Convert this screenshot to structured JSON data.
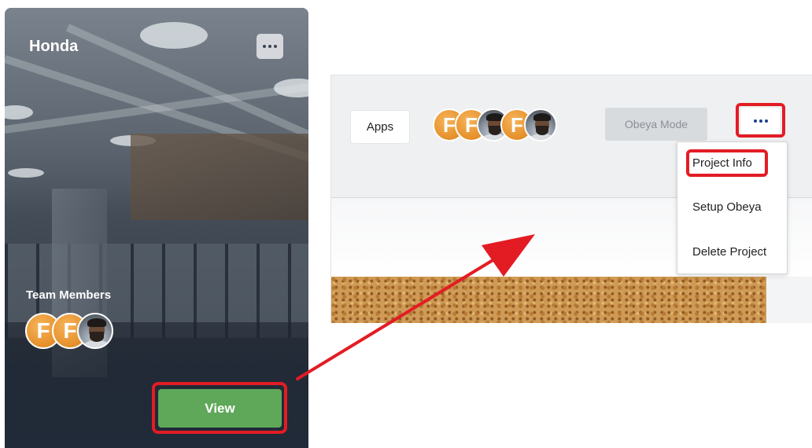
{
  "project_card": {
    "title": "Honda",
    "team_members_label": "Team Members",
    "view_label": "View",
    "avatars": [
      {
        "type": "initial",
        "letter": "F"
      },
      {
        "type": "initial",
        "letter": "F"
      },
      {
        "type": "photo"
      }
    ]
  },
  "header": {
    "apps_label": "Apps",
    "obeya_mode_label": "Obeya Mode",
    "avatars": [
      {
        "type": "initial",
        "letter": "F"
      },
      {
        "type": "initial",
        "letter": "F"
      },
      {
        "type": "photo"
      },
      {
        "type": "initial",
        "letter": "F"
      },
      {
        "type": "photo"
      }
    ]
  },
  "menu": {
    "items": [
      {
        "label": "Project Info"
      },
      {
        "label": "Setup Obeya"
      },
      {
        "label": "Delete Project"
      }
    ]
  },
  "colors": {
    "highlight": "#e31c24",
    "view_button": "#5fa85a",
    "avatar_orange": "#e58f2a",
    "more_dots": "#1f3d8a"
  }
}
